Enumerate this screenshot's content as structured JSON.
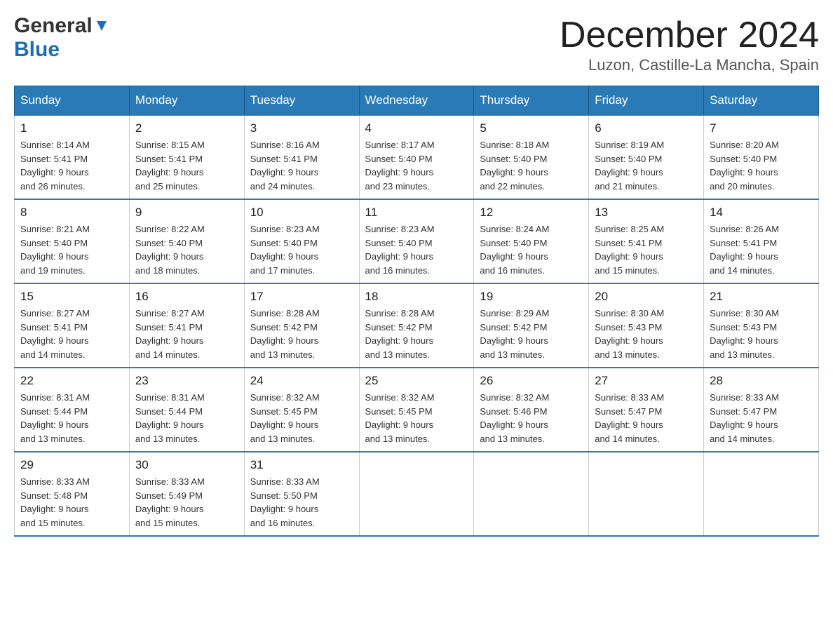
{
  "header": {
    "logo_general": "General",
    "logo_blue": "Blue",
    "month_title": "December 2024",
    "subtitle": "Luzon, Castille-La Mancha, Spain"
  },
  "weekdays": [
    "Sunday",
    "Monday",
    "Tuesday",
    "Wednesday",
    "Thursday",
    "Friday",
    "Saturday"
  ],
  "weeks": [
    [
      {
        "day": "1",
        "sunrise": "8:14 AM",
        "sunset": "5:41 PM",
        "daylight": "9 hours and 26 minutes."
      },
      {
        "day": "2",
        "sunrise": "8:15 AM",
        "sunset": "5:41 PM",
        "daylight": "9 hours and 25 minutes."
      },
      {
        "day": "3",
        "sunrise": "8:16 AM",
        "sunset": "5:41 PM",
        "daylight": "9 hours and 24 minutes."
      },
      {
        "day": "4",
        "sunrise": "8:17 AM",
        "sunset": "5:40 PM",
        "daylight": "9 hours and 23 minutes."
      },
      {
        "day": "5",
        "sunrise": "8:18 AM",
        "sunset": "5:40 PM",
        "daylight": "9 hours and 22 minutes."
      },
      {
        "day": "6",
        "sunrise": "8:19 AM",
        "sunset": "5:40 PM",
        "daylight": "9 hours and 21 minutes."
      },
      {
        "day": "7",
        "sunrise": "8:20 AM",
        "sunset": "5:40 PM",
        "daylight": "9 hours and 20 minutes."
      }
    ],
    [
      {
        "day": "8",
        "sunrise": "8:21 AM",
        "sunset": "5:40 PM",
        "daylight": "9 hours and 19 minutes."
      },
      {
        "day": "9",
        "sunrise": "8:22 AM",
        "sunset": "5:40 PM",
        "daylight": "9 hours and 18 minutes."
      },
      {
        "day": "10",
        "sunrise": "8:23 AM",
        "sunset": "5:40 PM",
        "daylight": "9 hours and 17 minutes."
      },
      {
        "day": "11",
        "sunrise": "8:23 AM",
        "sunset": "5:40 PM",
        "daylight": "9 hours and 16 minutes."
      },
      {
        "day": "12",
        "sunrise": "8:24 AM",
        "sunset": "5:40 PM",
        "daylight": "9 hours and 16 minutes."
      },
      {
        "day": "13",
        "sunrise": "8:25 AM",
        "sunset": "5:41 PM",
        "daylight": "9 hours and 15 minutes."
      },
      {
        "day": "14",
        "sunrise": "8:26 AM",
        "sunset": "5:41 PM",
        "daylight": "9 hours and 14 minutes."
      }
    ],
    [
      {
        "day": "15",
        "sunrise": "8:27 AM",
        "sunset": "5:41 PM",
        "daylight": "9 hours and 14 minutes."
      },
      {
        "day": "16",
        "sunrise": "8:27 AM",
        "sunset": "5:41 PM",
        "daylight": "9 hours and 14 minutes."
      },
      {
        "day": "17",
        "sunrise": "8:28 AM",
        "sunset": "5:42 PM",
        "daylight": "9 hours and 13 minutes."
      },
      {
        "day": "18",
        "sunrise": "8:28 AM",
        "sunset": "5:42 PM",
        "daylight": "9 hours and 13 minutes."
      },
      {
        "day": "19",
        "sunrise": "8:29 AM",
        "sunset": "5:42 PM",
        "daylight": "9 hours and 13 minutes."
      },
      {
        "day": "20",
        "sunrise": "8:30 AM",
        "sunset": "5:43 PM",
        "daylight": "9 hours and 13 minutes."
      },
      {
        "day": "21",
        "sunrise": "8:30 AM",
        "sunset": "5:43 PM",
        "daylight": "9 hours and 13 minutes."
      }
    ],
    [
      {
        "day": "22",
        "sunrise": "8:31 AM",
        "sunset": "5:44 PM",
        "daylight": "9 hours and 13 minutes."
      },
      {
        "day": "23",
        "sunrise": "8:31 AM",
        "sunset": "5:44 PM",
        "daylight": "9 hours and 13 minutes."
      },
      {
        "day": "24",
        "sunrise": "8:32 AM",
        "sunset": "5:45 PM",
        "daylight": "9 hours and 13 minutes."
      },
      {
        "day": "25",
        "sunrise": "8:32 AM",
        "sunset": "5:45 PM",
        "daylight": "9 hours and 13 minutes."
      },
      {
        "day": "26",
        "sunrise": "8:32 AM",
        "sunset": "5:46 PM",
        "daylight": "9 hours and 13 minutes."
      },
      {
        "day": "27",
        "sunrise": "8:33 AM",
        "sunset": "5:47 PM",
        "daylight": "9 hours and 14 minutes."
      },
      {
        "day": "28",
        "sunrise": "8:33 AM",
        "sunset": "5:47 PM",
        "daylight": "9 hours and 14 minutes."
      }
    ],
    [
      {
        "day": "29",
        "sunrise": "8:33 AM",
        "sunset": "5:48 PM",
        "daylight": "9 hours and 15 minutes."
      },
      {
        "day": "30",
        "sunrise": "8:33 AM",
        "sunset": "5:49 PM",
        "daylight": "9 hours and 15 minutes."
      },
      {
        "day": "31",
        "sunrise": "8:33 AM",
        "sunset": "5:50 PM",
        "daylight": "9 hours and 16 minutes."
      },
      null,
      null,
      null,
      null
    ]
  ],
  "labels": {
    "sunrise": "Sunrise:",
    "sunset": "Sunset:",
    "daylight": "Daylight:"
  }
}
